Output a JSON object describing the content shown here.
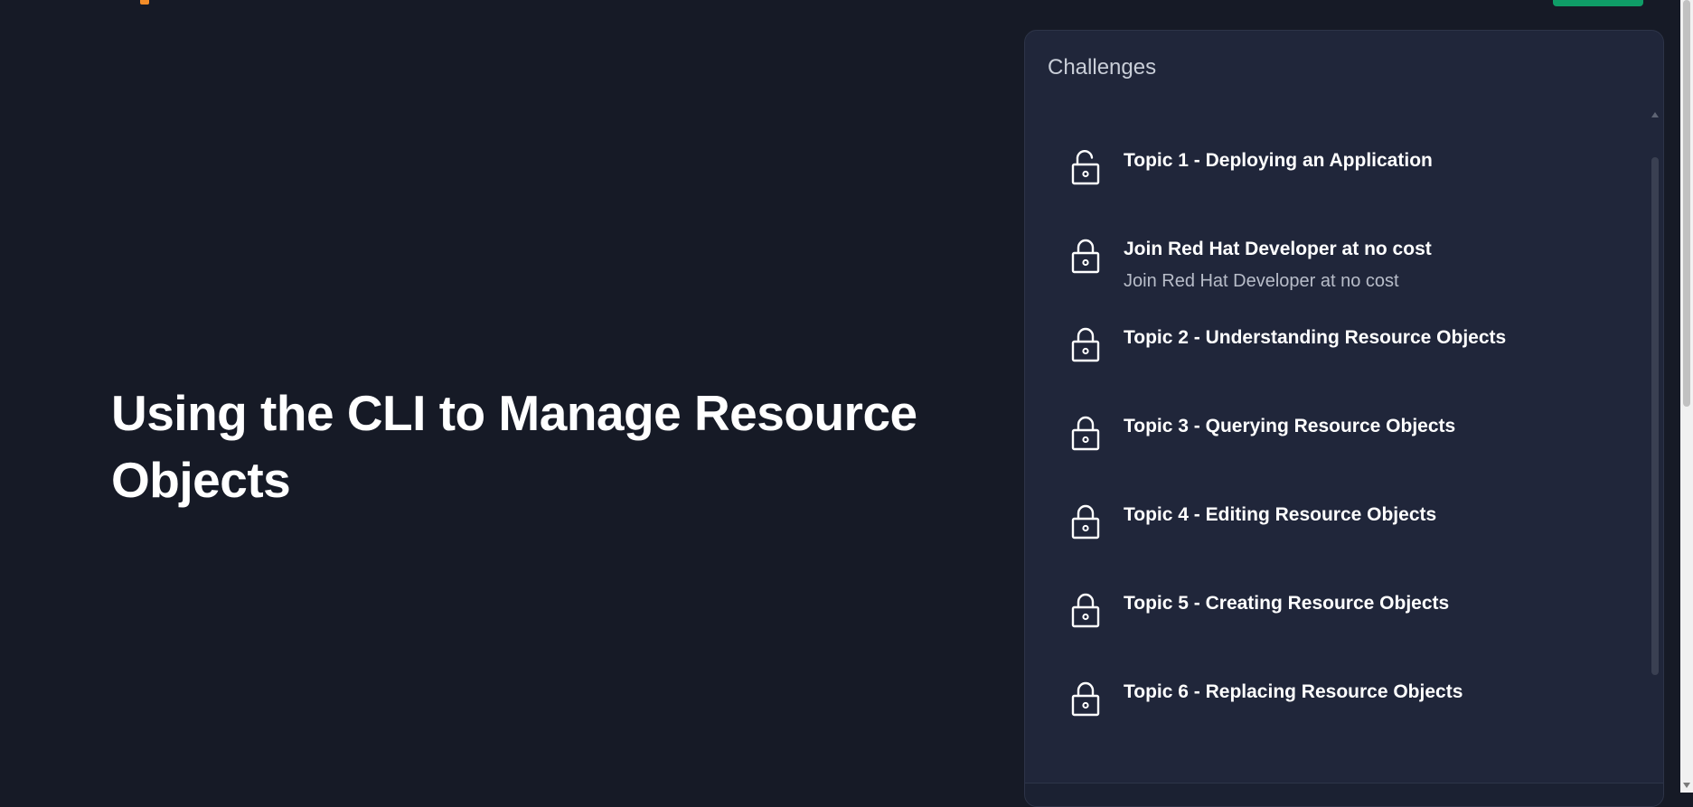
{
  "page": {
    "title": "Using the CLI to Manage Resource Objects"
  },
  "challenges": {
    "heading": "Challenges",
    "items": [
      {
        "title": "Topic 1 - Deploying an Application",
        "subtitle": "",
        "icon": "unlocked-padlock-icon"
      },
      {
        "title": "Join Red Hat Developer at no cost",
        "subtitle": "Join Red Hat Developer at no cost",
        "icon": "locked-padlock-icon"
      },
      {
        "title": "Topic 2 - Understanding Resource Objects",
        "subtitle": "",
        "icon": "locked-padlock-icon"
      },
      {
        "title": "Topic 3 - Querying Resource Objects",
        "subtitle": "",
        "icon": "locked-padlock-icon"
      },
      {
        "title": "Topic 4 - Editing Resource Objects",
        "subtitle": "",
        "icon": "locked-padlock-icon"
      },
      {
        "title": "Topic 5 - Creating Resource Objects",
        "subtitle": "",
        "icon": "locked-padlock-icon"
      },
      {
        "title": "Topic 6 - Replacing Resource Objects",
        "subtitle": "",
        "icon": "locked-padlock-icon"
      }
    ]
  },
  "colors": {
    "background": "#161a26",
    "panel": "#20263a",
    "accent_orange": "#f28c28",
    "accent_green": "#0f9d67",
    "text_primary": "#ffffff",
    "text_secondary": "#b8bdc9"
  }
}
